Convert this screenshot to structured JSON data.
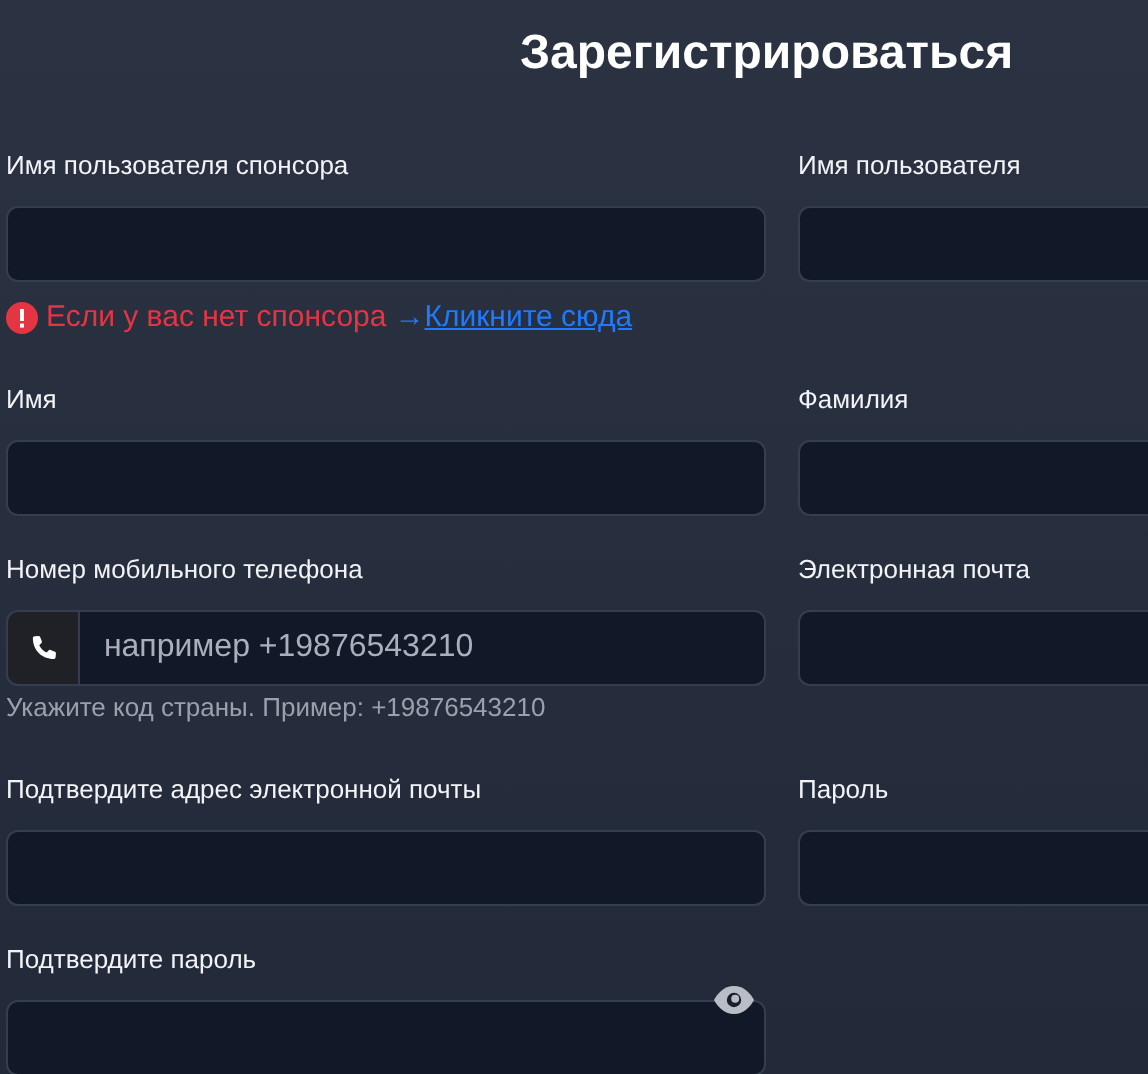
{
  "title": "Зарегистрироваться",
  "rows": [
    {
      "fields": [
        {
          "label": "Имя пользователя спонсора",
          "kind": "text"
        },
        {
          "label": "Имя пользователя",
          "kind": "text"
        }
      ],
      "notice": {
        "text": "Если у вас нет спонсора",
        "arrow": "→",
        "link": "Кликните сюда"
      }
    },
    {
      "fields": [
        {
          "label": "Имя",
          "kind": "text"
        },
        {
          "label": "Фамилия",
          "kind": "text"
        }
      ]
    },
    {
      "fields": [
        {
          "label": "Номер мобильного телефона",
          "kind": "phone",
          "placeholder": "например +19876543210",
          "help": "Укажите код страны. Пример: +19876543210"
        },
        {
          "label": "Электронная почта",
          "kind": "text"
        }
      ]
    },
    {
      "fields": [
        {
          "label": "Подтвердите адрес электронной почты",
          "kind": "text"
        },
        {
          "label": "Пароль",
          "kind": "text"
        }
      ]
    },
    {
      "fields": [
        {
          "label": "Подтвердите пароль",
          "kind": "password"
        }
      ]
    }
  ]
}
